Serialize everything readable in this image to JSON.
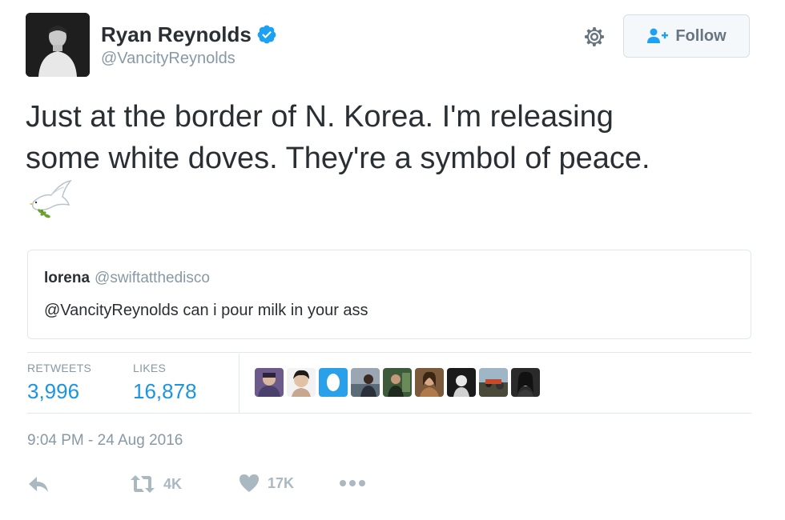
{
  "author": {
    "name": "Ryan Reynolds",
    "handle": "@VancityReynolds",
    "verified": true
  },
  "header": {
    "follow_label": "Follow"
  },
  "tweet": {
    "lines": [
      "Just at the border of N. Korea. I'm releasing",
      "some white doves. They're a symbol of peace."
    ],
    "emoji": "dove-icon"
  },
  "quoted_tweet": {
    "name": "lorena",
    "handle": "@swiftatthedisco",
    "text": "@VancityReynolds can i pour milk in your ass"
  },
  "stats": {
    "retweets_label": "RETWEETS",
    "retweets_value": "3,996",
    "likes_label": "LIKES",
    "likes_value": "16,878"
  },
  "likers_count_shown": 9,
  "timestamp": "9:04 PM - 24 Aug 2016",
  "actions": {
    "retweet_count": "4K",
    "like_count": "17K"
  },
  "colors": {
    "accent": "#1b95e0",
    "muted": "#8899a6",
    "icon": "#aab8c2",
    "verified": "#1da1f2"
  }
}
